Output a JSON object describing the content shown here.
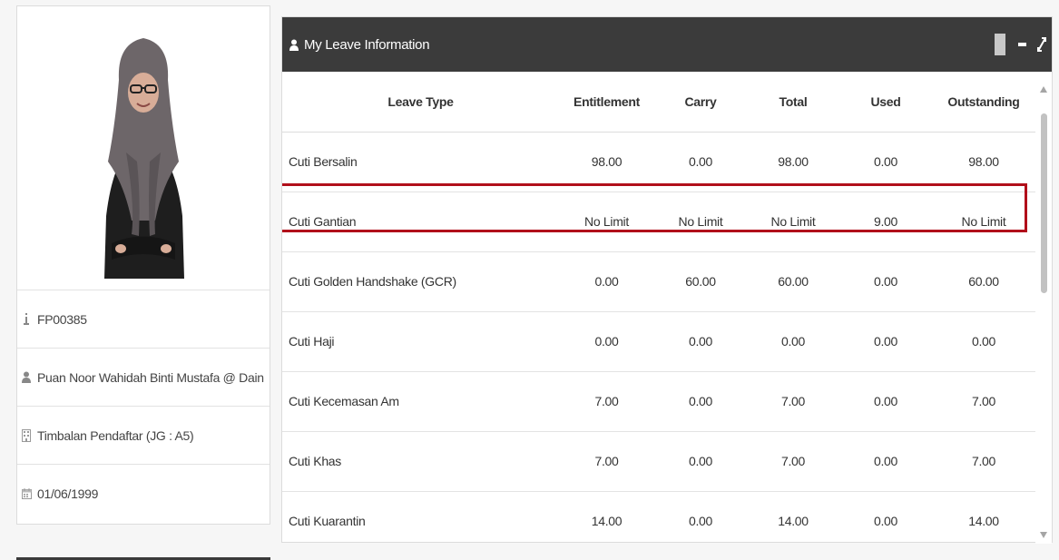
{
  "profile": {
    "staff_id": "FP00385",
    "name": "Puan Noor Wahidah Binti Mustafa @ Dain",
    "position": "Timbalan Pendaftar (JG : A5)",
    "date": "01/06/1999",
    "icons": [
      "info-icon",
      "user-icon",
      "building-icon",
      "calendar-icon"
    ]
  },
  "leave_panel": {
    "title": "My Leave Information",
    "header_color": "#3b3b3b",
    "highlight_color": "#b10f1a",
    "columns": {
      "type": "Leave Type",
      "entitlement": "Entitlement",
      "carry": "Carry",
      "total": "Total",
      "used": "Used",
      "outstanding": "Outstanding"
    },
    "rows": [
      {
        "type": "Cuti Bersalin",
        "entitlement": "98.00",
        "carry": "0.00",
        "total": "98.00",
        "used": "0.00",
        "outstanding": "98.00"
      },
      {
        "type": "Cuti Gantian",
        "entitlement": "No Limit",
        "carry": "No Limit",
        "total": "No Limit",
        "used": "9.00",
        "outstanding": "No Limit"
      },
      {
        "type": "Cuti Golden Handshake (GCR)",
        "entitlement": "0.00",
        "carry": "60.00",
        "total": "60.00",
        "used": "0.00",
        "outstanding": "60.00"
      },
      {
        "type": "Cuti Haji",
        "entitlement": "0.00",
        "carry": "0.00",
        "total": "0.00",
        "used": "0.00",
        "outstanding": "0.00"
      },
      {
        "type": "Cuti Kecemasan Am",
        "entitlement": "7.00",
        "carry": "0.00",
        "total": "7.00",
        "used": "0.00",
        "outstanding": "7.00"
      },
      {
        "type": "Cuti Khas",
        "entitlement": "7.00",
        "carry": "0.00",
        "total": "7.00",
        "used": "0.00",
        "outstanding": "7.00"
      },
      {
        "type": "Cuti Kuarantin",
        "entitlement": "14.00",
        "carry": "0.00",
        "total": "14.00",
        "used": "0.00",
        "outstanding": "14.00"
      }
    ]
  }
}
